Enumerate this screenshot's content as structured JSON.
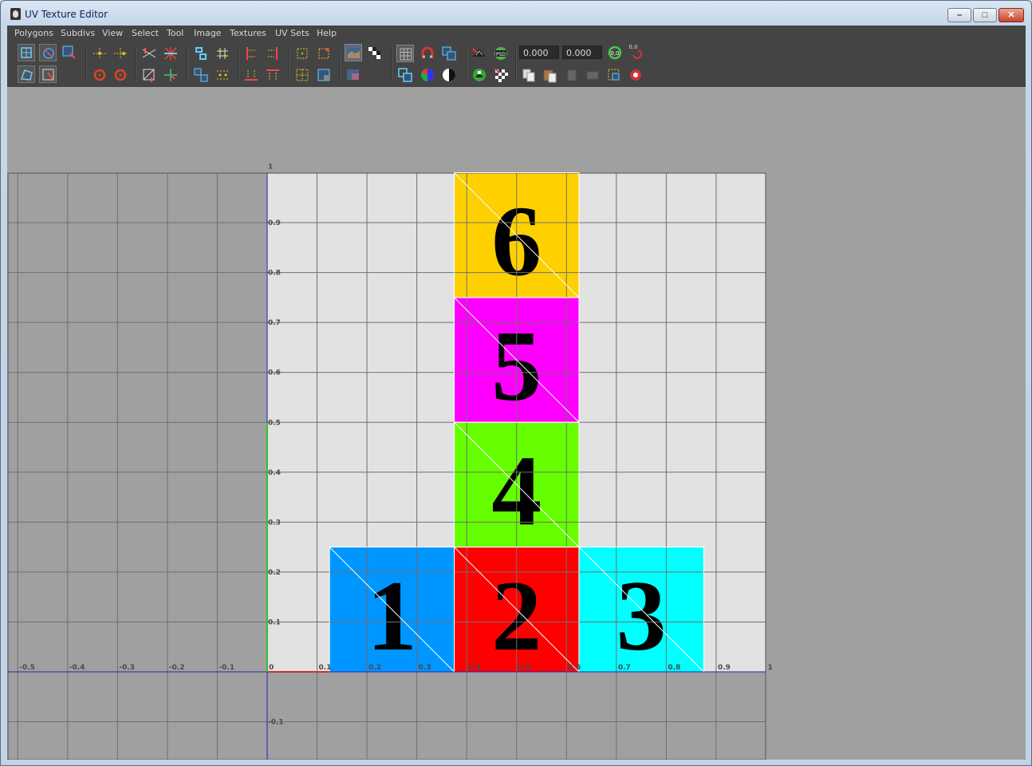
{
  "window": {
    "title": "UV Texture Editor"
  },
  "menu": [
    "Polygons",
    "Subdivs",
    "View",
    "Select",
    "Tool",
    "Image",
    "Textures",
    "UV Sets",
    "Help"
  ],
  "toolbar": {
    "u_value": "0.000",
    "v_value": "0.000",
    "psd_label": "PSD",
    "zero_label": "0,0",
    "reset_label": "0,0"
  },
  "grid": {
    "u_axis_labels": [
      "-0.5",
      "-0.4",
      "-0.3",
      "-0.2",
      "-0.1",
      "0",
      "0.1",
      "0.2",
      "0.3",
      "0.4",
      "0.5",
      "0.6",
      "0.7",
      "0.8",
      "0.9",
      "1"
    ],
    "v_axis_labels": [
      "1",
      "0.9",
      "0.8",
      "0.7",
      "0.6",
      "0.5",
      "0.4",
      "0.3",
      "0.2",
      "0.1",
      "-0.1"
    ]
  },
  "uv_tiles": [
    {
      "number": "1",
      "color": "#0096ff"
    },
    {
      "number": "2",
      "color": "#ff0000"
    },
    {
      "number": "3",
      "color": "#00ffff"
    },
    {
      "number": "4",
      "color": "#66ff00"
    },
    {
      "number": "5",
      "color": "#ff00ff"
    },
    {
      "number": "6",
      "color": "#ffd000"
    }
  ]
}
